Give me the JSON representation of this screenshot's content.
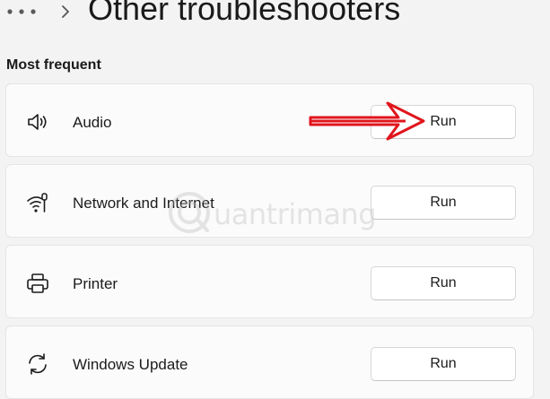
{
  "header": {
    "title": "Other troubleshooters",
    "more_icon": "more-horizontal-icon",
    "breadcrumb_chevron_icon": "chevron-right-icon"
  },
  "section": {
    "label": "Most frequent"
  },
  "troubleshooters": [
    {
      "name": "Audio",
      "icon": "speaker-icon",
      "button_label": "Run"
    },
    {
      "name": "Network and Internet",
      "icon": "network-wifi-icon",
      "button_label": "Run"
    },
    {
      "name": "Printer",
      "icon": "printer-icon",
      "button_label": "Run"
    },
    {
      "name": "Windows Update",
      "icon": "sync-icon",
      "button_label": "Run"
    }
  ],
  "annotation": {
    "color": "#e0151c",
    "icon": "red-arrow-annotation"
  },
  "watermark": {
    "text": "uantrimang",
    "color": "#b9b9b9"
  },
  "colors": {
    "background": "#f3f3f3",
    "card": "#fbfbfb",
    "button": "#ffffff"
  }
}
